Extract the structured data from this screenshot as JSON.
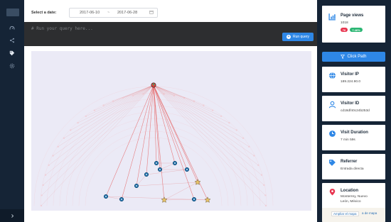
{
  "date_filter": {
    "label": "Select a date:",
    "from": "2017-06-10",
    "separator": "~",
    "to": "2017-06-28"
  },
  "query": {
    "placeholder": "# Run your query here...",
    "run_label": "Run query"
  },
  "sidebar": {
    "items": [
      {
        "icon": "gauge-icon"
      },
      {
        "icon": "share-icon"
      },
      {
        "icon": "tag-icon"
      },
      {
        "icon": "settings-icon"
      }
    ],
    "footer_icon": "chevron-right-icon"
  },
  "panel": {
    "page_views": {
      "title": "Page views",
      "value": "1018",
      "badge_count": "76",
      "badge_count_color": "#e8344f",
      "badge_percent": "7.46%",
      "badge_percent_color": "#2bb673"
    },
    "click_path_label": "Click Path",
    "visitor_ip": {
      "title": "Visitor IP",
      "value": "189.224.90.0"
    },
    "visitor_id": {
      "title": "Visitor ID",
      "value": "cd18df40c24b253d"
    },
    "visit_duration": {
      "title": "Visit Duration",
      "value": "7 min 59s"
    },
    "referrer": {
      "title": "Referrer",
      "value": "Entrada directa"
    },
    "location": {
      "title": "Location",
      "value_line1": "Monterrey, Nuevo",
      "value_line2": "León, México",
      "map_button": "Ampliar el mapa",
      "map_button2": "a de mapa"
    }
  },
  "colors": {
    "accent": "#2e87e6",
    "sidebar": "#152436",
    "graph_bg": "#ebeaf6",
    "edge": "#e45a5a",
    "node_blue": "#1f6fa8",
    "node_star": "#e9c46a"
  }
}
